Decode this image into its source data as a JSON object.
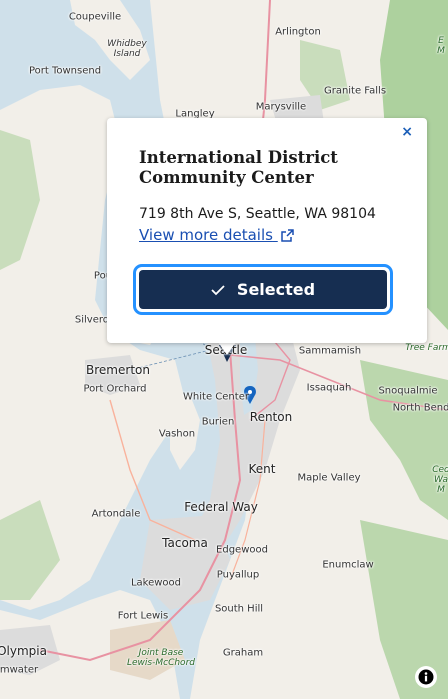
{
  "map": {
    "labels": {
      "coupeville": "Coupeville",
      "whidbey_island": "Whidbey\nIsland",
      "arlington": "Arlington",
      "port_townsend": "Port Townsend",
      "marysville": "Marysville",
      "granite_falls": "Granite Falls",
      "langley": "Langley",
      "poulsbo_partial": "Pou",
      "silverdale_partial": "Silverd",
      "seattle": "Seattle",
      "sammamish": "Sammamish",
      "bremerton": "Bremerton",
      "issaquah": "Issaquah",
      "snoqualmie": "Snoqualmie",
      "port_orchard": "Port Orchard",
      "white_center": "White Center",
      "renton": "Renton",
      "north_bend": "North Bend",
      "burien": "Burien",
      "vashon": "Vashon",
      "kent": "Kent",
      "maple_valley": "Maple Valley",
      "federal_way": "Federal Way",
      "artondale": "Artondale",
      "tacoma": "Tacoma",
      "edgewood": "Edgewood",
      "enumclaw": "Enumclaw",
      "lakewood": "Lakewood",
      "puyallup": "Puyallup",
      "fort_lewis": "Fort Lewis",
      "south_hill": "South Hill",
      "olympia": "Olympia",
      "joint_base": "Joint Base\nLewis-McChord",
      "graham": "Graham",
      "tumwater_partial": "mwater",
      "tree_farm": "Tree Farm",
      "edge_mountain": "E\nM",
      "cedar_partial": "Ced\nWa\nM"
    },
    "colors": {
      "water": "#cfe0ea",
      "land": "#f2efe9",
      "forest": "#add19e",
      "urban": "#dcdcdc",
      "pin": "#1565c0",
      "selected_marker": "#162e51"
    }
  },
  "popup": {
    "close_label": "×",
    "title": "International District Community Center",
    "address": "719 8th Ave S, Seattle, WA 98104",
    "link_label": "View more details",
    "select_label": "Selected"
  },
  "attribution": {
    "icon": "info-icon"
  }
}
